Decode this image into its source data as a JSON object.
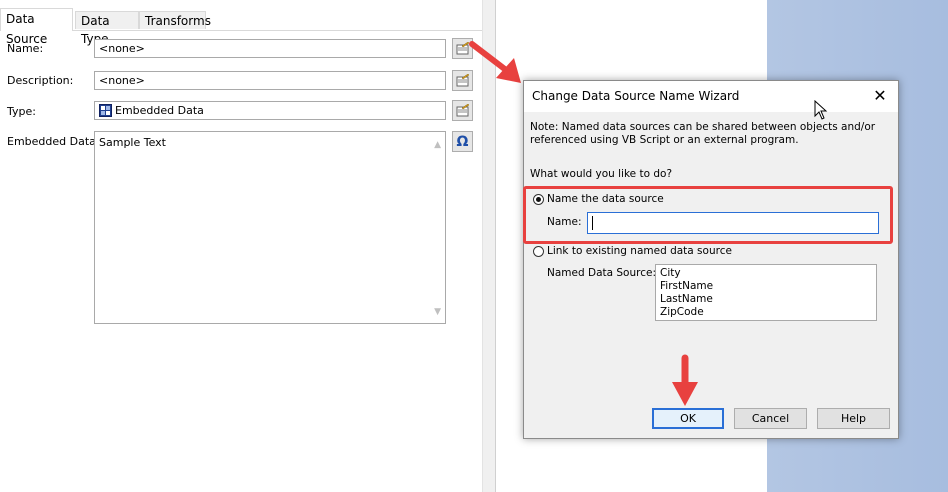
{
  "tabs": [
    {
      "label": "Data Source",
      "active": true
    },
    {
      "label": "Data Type",
      "active": false
    },
    {
      "label": "Transforms",
      "active": false
    }
  ],
  "fields": {
    "name": {
      "label": "Name:",
      "value": "<none>"
    },
    "description": {
      "label": "Description:",
      "value": "<none>"
    },
    "type": {
      "label": "Type:",
      "value": "Embedded Data"
    },
    "embedded": {
      "label": "Embedded Data:",
      "value": "Sample Text"
    }
  },
  "omega_button": "Ω",
  "dialog": {
    "title": "Change Data Source Name Wizard",
    "close": "✕",
    "note": "Note: Named data sources can be shared between objects and/or referenced using VB Script or an external program.",
    "question": "What would you like to do?",
    "option_name": "Name the data source",
    "name_label": "Name:",
    "name_value": "",
    "option_link": "Link to existing named data source",
    "named_source_label": "Named Data Source:",
    "named_sources": [
      "City",
      "FirstName",
      "LastName",
      "ZipCode"
    ],
    "ok": "OK",
    "cancel": "Cancel",
    "help": "Help"
  },
  "colors": {
    "highlight": "#e8413f",
    "focus": "#2a6fd6",
    "desktop": "#a7bddf"
  },
  "icons": [
    "edit-icon",
    "database-icon",
    "omega-icon",
    "close-icon",
    "red-arrow-icon",
    "mouse-cursor-icon"
  ]
}
